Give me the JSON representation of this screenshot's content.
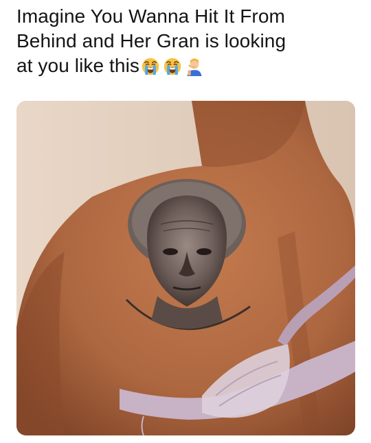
{
  "post": {
    "caption_lines": [
      "Imagine You Wanna Hit It From",
      "Behind  and Her Gran is looking",
      "at you like this"
    ],
    "emojis": [
      "loudly-crying-face-icon",
      "loudly-crying-face-icon",
      "person-facepalming-icon"
    ]
  },
  "photo": {
    "subject": "",
    "colors": {
      "wall": "#ead8c8",
      "skin": "#b06a43",
      "tattoo_ink": "#3a2f2b",
      "bra": "#c8b2c6"
    }
  }
}
